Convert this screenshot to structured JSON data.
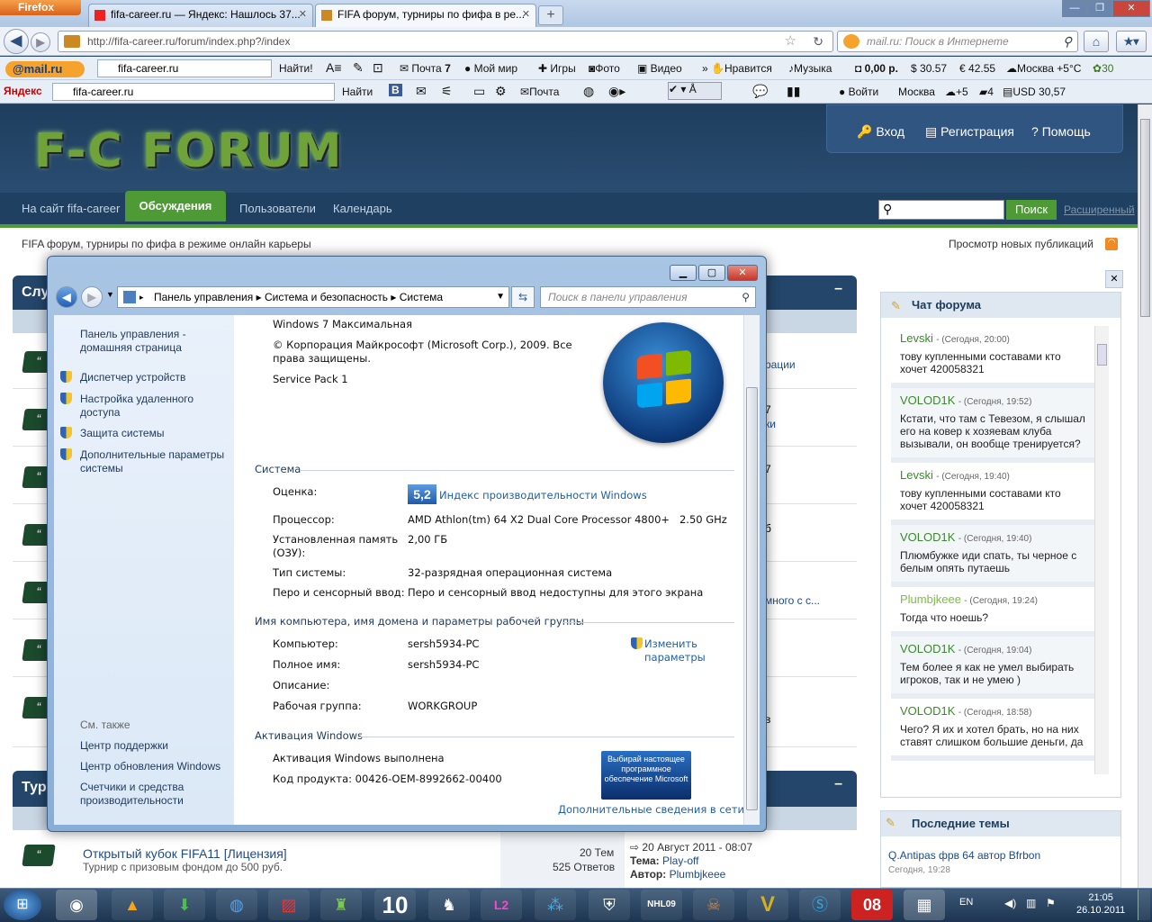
{
  "browser": {
    "app_button": "Firefox",
    "tabs": [
      {
        "title": "fifa-career.ru — Яндекс: Нашлось 37..."
      },
      {
        "title": "FIFA форум, турниры по фифа в ре..."
      }
    ],
    "new_tab": "+",
    "url": "http://fifa-career.ru/forum/index.php?/index",
    "search_placeholder": "mail.ru: Поиск в Интернете"
  },
  "toolbar_mailru": {
    "logo": "@mail.ru",
    "search_value": "fifa-career.ru",
    "find": "Найти!",
    "mail": "Почта",
    "mail_count": "7",
    "my_world": "Мой мир",
    "games": "Игры",
    "photo": "Фото",
    "video": "Видео",
    "likes": "Нравится",
    "music": "Музыка",
    "balance": "0,00 р.",
    "usd": "30.57",
    "eur": "42.55",
    "weather": "Москва +5°C",
    "count30": "30"
  },
  "toolbar_yandex": {
    "logo": "Яндекс",
    "search_value": "fifa-career.ru",
    "find": "Найти",
    "mail": "Почта",
    "login": "Войти",
    "city": "Москва",
    "temp": "+5",
    "num": "4",
    "usd": "USD 30,57"
  },
  "forum": {
    "logo": "F-C FORUM",
    "top_links": [
      "Вход",
      "Регистрация",
      "Помощь"
    ],
    "nav": [
      "На сайт fifa-career",
      "Обсуждения",
      "Пользователи",
      "Календарь"
    ],
    "search_button": "Поиск",
    "advanced": "Расширенный",
    "breadcrumb": "FIFA форум, турниры по фифа в режиме онлайн карьеры",
    "new_pubs": "Просмотр новых публикаций",
    "block1_title": "Слу",
    "block2_title": "Тур",
    "partial_texts": [
      "рации",
      "7",
      "ки",
      "7",
      "б",
      "много с с...",
      "в"
    ],
    "cup": {
      "title": "Открытый кубок FIFA11 [Лицензия]",
      "desc": "Турнир с призовым фондом до 500 руб.",
      "topics": "20 Тем",
      "replies": "525 Ответов",
      "date": "20 Август 2011 - 08:07",
      "theme_label": "Тема:",
      "theme": "Play-off",
      "author_label": "Автор:",
      "author": "Plumbjkeee"
    },
    "chat_title": "Чат форума",
    "chat": [
      {
        "user": "Levski",
        "time": "(Сегодня, 20:00)",
        "text": "тову купленными составами кто хочет 420058321"
      },
      {
        "user": "VOLOD1K",
        "time": "(Сегодня, 19:52)",
        "text": "Кстати, что там с Тевезом, я слышал его на ковер к хозяевам клуба вызывали, он вообще тренируется?"
      },
      {
        "user": "Levski",
        "time": "(Сегодня, 19:40)",
        "text": "тову купленными составами кто хочет 420058321"
      },
      {
        "user": "VOLOD1K",
        "time": "(Сегодня, 19:40)",
        "text": "Плюмбужке иди спать, ты черное с белым опять путаешь"
      },
      {
        "user": "Plumbjkeee",
        "time": "(Сегодня, 19:24)",
        "text": "Тогда что ноешь?"
      },
      {
        "user": "VOLOD1K",
        "time": "(Сегодня, 19:04)",
        "text": "Тем более я как не умел выбирать игроков, так и не умею )"
      },
      {
        "user": "VOLOD1K",
        "time": "(Сегодня, 18:58)",
        "text": "Чего? Я их и хотел брать, но на них ставят слишком большие деньги, да"
      }
    ],
    "last_topics_title": "Последние темы",
    "last_topic": "Q.Antipas фрв 64 автор Bfrbon",
    "last_topic_time": "Сегодня, 19:28"
  },
  "dialog": {
    "breadcrumb": [
      "Панель управления",
      "Система и безопасность",
      "Система"
    ],
    "search_placeholder": "Поиск в панели управления",
    "left_links": [
      "Панель управления - домашняя страница"
    ],
    "left_tasks": [
      "Диспетчер устройств",
      "Настройка удаленного доступа",
      "Защита системы",
      "Дополнительные параметры системы"
    ],
    "see_also": "См. также",
    "see_also_links": [
      "Центр поддержки",
      "Центр обновления Windows",
      "Счетчики и средства производительности"
    ],
    "edition": "Windows 7 Максимальная",
    "copyright": "© Корпорация Майкрософт (Microsoft Corp.), 2009. Все права защищены.",
    "sp": "Service Pack 1",
    "system_title": "Система",
    "rating_label": "Оценка:",
    "rating_value": "5,2",
    "rating_link": "Индекс производительности Windows",
    "cpu_label": "Процессор:",
    "cpu": "AMD Athlon(tm) 64 X2 Dual Core Processor 4800+   2.50 GHz",
    "ram_label": "Установленная память (ОЗУ):",
    "ram": "2,00 ГБ",
    "type_label": "Тип системы:",
    "type": "32-разрядная операционная система",
    "pen_label": "Перо и сенсорный ввод:",
    "pen": "Перо и сенсорный ввод недоступны для этого экрана",
    "computer_title": "Имя компьютера, имя домена и параметры рабочей группы",
    "comp_label": "Компьютер:",
    "comp": "sersh5934-PC",
    "full_label": "Полное имя:",
    "full": "sersh5934-PC",
    "desc_label": "Описание:",
    "wg_label": "Рабочая группа:",
    "wg": "WORKGROUP",
    "change": "Изменить параметры",
    "activation_title": "Активация Windows",
    "activated": "Активация Windows выполнена",
    "key_label": "Код продукта:",
    "key": "00426-OEM-8992662-00400",
    "genuine": "Выбирай настоящее программное обеспечение Microsoft",
    "more": "Дополнительные сведения в сети..."
  },
  "taskbar": {
    "lang": "EN",
    "time": "21:05",
    "date": "26.10.2011",
    "icons": [
      "10",
      "L2",
      "NHL09",
      "08"
    ]
  }
}
